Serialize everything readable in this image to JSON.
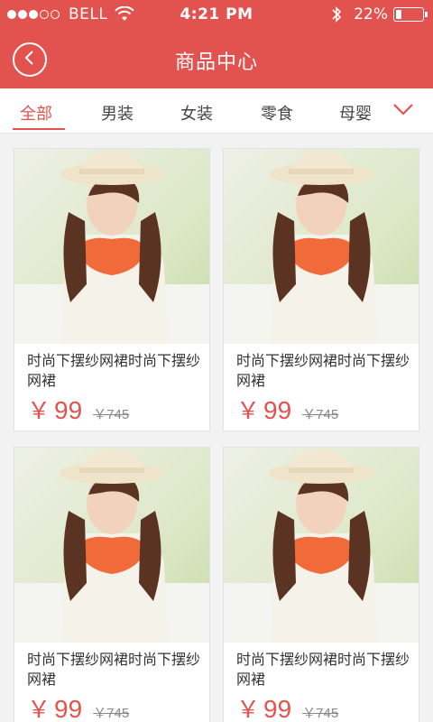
{
  "status_bar": {
    "carrier": "BELL",
    "time": "4:21 PM",
    "battery_percent": "22%",
    "battery_level": 0.22,
    "signal_bars_filled": 3,
    "signal_bars_total": 5
  },
  "nav": {
    "title": "商品中心",
    "back_icon": "chevron-left-icon"
  },
  "tabs": [
    {
      "label": "全部",
      "active": true
    },
    {
      "label": "男装",
      "active": false
    },
    {
      "label": "女装",
      "active": false
    },
    {
      "label": "零食",
      "active": false
    },
    {
      "label": "母婴",
      "active": false
    }
  ],
  "tabs_expand_icon": "chevron-down-icon",
  "products": [
    {
      "title": "时尚下摆纱网裙时尚下摆纱网裙",
      "currency": "￥",
      "price": "99",
      "original_price": "￥745"
    },
    {
      "title": "时尚下摆纱网裙时尚下摆纱网裙",
      "currency": "￥",
      "price": "99",
      "original_price": "￥745"
    },
    {
      "title": "时尚下摆纱网裙时尚下摆纱网裙",
      "currency": "￥",
      "price": "99",
      "original_price": "￥745"
    },
    {
      "title": "时尚下摆纱网裙时尚下摆纱网裙",
      "currency": "￥",
      "price": "99",
      "original_price": "￥745"
    }
  ],
  "colors": {
    "accent": "#e2534f",
    "background": "#f2f2f2"
  }
}
